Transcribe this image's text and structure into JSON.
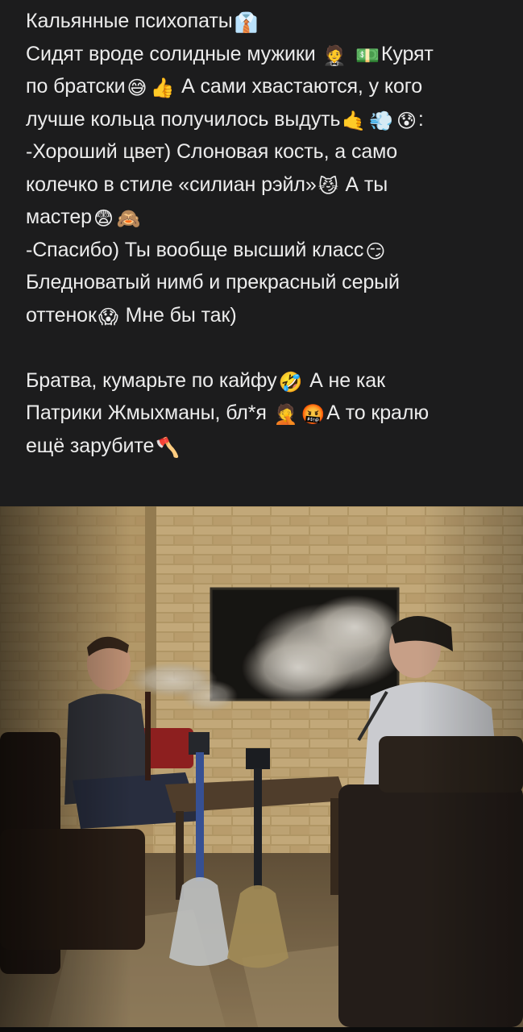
{
  "post": {
    "lines": [
      [
        {
          "t": "Кальянные психопаты"
        },
        {
          "e": "👔"
        }
      ],
      [
        {
          "t": "Сидят вроде солидные мужики "
        },
        {
          "e": "🤵"
        },
        {
          "t": " "
        },
        {
          "e": "💵"
        },
        {
          "t": "Курят"
        }
      ],
      [
        {
          "t": "по братски"
        },
        {
          "e": "😅"
        },
        {
          "e": "👍"
        },
        {
          "t": " А сами хвастаются, у кого"
        }
      ],
      [
        {
          "t": "лучше кольца получилось выдуть"
        },
        {
          "e": "🤙"
        },
        {
          "e": "💨"
        },
        {
          "e": "😰"
        },
        {
          "t": ":"
        }
      ],
      [
        {
          "t": "-Хороший цвет) Слоновая кость, а само"
        }
      ],
      [
        {
          "t": "колечко в стиле «силиан рэйл»"
        },
        {
          "e": "😼"
        },
        {
          "t": " А ты"
        }
      ],
      [
        {
          "t": "мастер"
        },
        {
          "e": "😨"
        },
        {
          "e": "🙈"
        }
      ],
      [
        {
          "t": "-Спасибо) Ты вообще высший класс"
        },
        {
          "e": "😏"
        }
      ],
      [
        {
          "t": "Бледноватый нимб и прекрасный серый"
        }
      ],
      [
        {
          "t": "оттенок"
        },
        {
          "e": "😱"
        },
        {
          "t": " Мне бы так)"
        }
      ],
      [],
      [
        {
          "t": "Братва, кумарьте по кайфу"
        },
        {
          "e": "🤣"
        },
        {
          "t": " А не как"
        }
      ],
      [
        {
          "t": "Патрики Жмыхманы, бл*я "
        },
        {
          "e": "🤦"
        },
        {
          "e": "🤬"
        },
        {
          "t": "А то кралю"
        }
      ],
      [
        {
          "t": "ещё зарубите"
        },
        {
          "e": "🪓"
        }
      ]
    ]
  },
  "colors": {
    "background": "#1c1c1d",
    "text": "#ececec"
  }
}
